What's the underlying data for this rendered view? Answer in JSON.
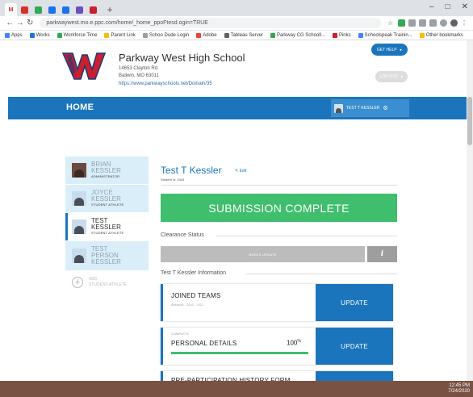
{
  "browser": {
    "tabs": [
      {
        "letter": "M",
        "color": "#d93025"
      },
      {
        "letter": "",
        "color": "#d93025"
      },
      {
        "letter": "",
        "color": "#34a853"
      },
      {
        "letter": "",
        "color": "#1a73e8"
      },
      {
        "letter": "",
        "color": "#1a73e8"
      },
      {
        "letter": "",
        "color": "#6b4fbb"
      },
      {
        "letter": "",
        "color": "#5f6368"
      }
    ],
    "new_tab": "+",
    "url": "parkwaywest.mo.e.ppc.com/home/_home_ppoFtesd.ogin=TRUE",
    "bookmarks": [
      "Apps",
      "Works",
      "Workforce Time",
      "Parent Link",
      "Schoo Dude Login",
      "Adobe",
      "Tableau Server",
      "Parkway CG Schooll...",
      "Pinks",
      "Schoolspeak Trainin...",
      "Other bookmarks"
    ]
  },
  "school": {
    "name": "Parkway West High School",
    "address1": "14653 Clayton Rd.",
    "address2": "Ballwin, MO 63011",
    "link": "https://www.parkwayschools.net/Domain/35",
    "help_label": "GET HELP",
    "logout_label": "LOG OUT"
  },
  "nav": {
    "home": "HOME",
    "user": "TEST T KESSLER"
  },
  "students": [
    {
      "first": "BRIAN",
      "last": "KESSLER",
      "role": "ADMINISTRATOR",
      "photo": true,
      "active": false
    },
    {
      "first": "JOYCE",
      "last": "KESSLER",
      "role": "STUDENT ATHLETE",
      "photo": false,
      "active": false
    },
    {
      "first": "TEST",
      "last": "KESSLER",
      "role": "STUDENT ATHLETE",
      "photo": false,
      "active": true
    },
    {
      "first": "TEST",
      "last": "PERSON",
      "middle": "KESSLER",
      "role": "",
      "photo": false,
      "active": false
    }
  ],
  "add_student": {
    "line1": "ADD",
    "line2": "STUDENT-ATHLETE"
  },
  "main": {
    "student_name": "Test T Kessler",
    "edit": "Edit",
    "student_id": "Student Id: 3444",
    "banner": "SUBMISSION COMPLETE",
    "clearance_label": "Clearance Status",
    "needs_update": "NEEDS UPDATE",
    "info_icon": "i",
    "info_label": "Test T Kessler Information",
    "cards": [
      {
        "status": "",
        "title": "JOINED TEAMS",
        "sub": "Baseball - 2020 - 2021",
        "button": "UPDATE"
      },
      {
        "status": "COMPLETE",
        "title": "PERSONAL DETAILS",
        "percent": "100",
        "percent_sign": "%",
        "progress": 1.0,
        "button": "UPDATE"
      },
      {
        "status": "",
        "title": "PRE-PARTICIPATION HISTORY FORM",
        "button": "UPDATE"
      }
    ]
  },
  "taskbar": {
    "time": "12:45 PM",
    "date": "7/24/2020"
  },
  "colors": {
    "brand_blue": "#1b75bc",
    "success_green": "#3fbf6d",
    "logo_red": "#c8202f"
  }
}
